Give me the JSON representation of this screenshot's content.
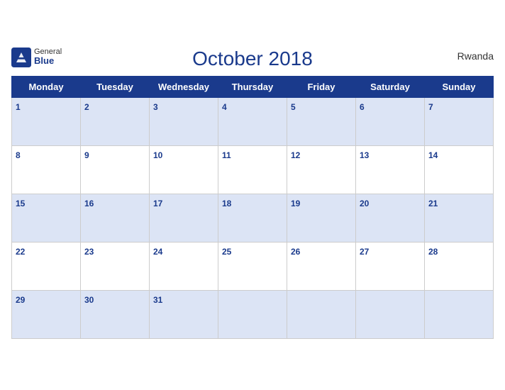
{
  "header": {
    "logo_general": "General",
    "logo_blue": "Blue",
    "month_title": "October 2018",
    "country": "Rwanda"
  },
  "weekdays": [
    "Monday",
    "Tuesday",
    "Wednesday",
    "Thursday",
    "Friday",
    "Saturday",
    "Sunday"
  ],
  "weeks": [
    [
      1,
      2,
      3,
      4,
      5,
      6,
      7
    ],
    [
      8,
      9,
      10,
      11,
      12,
      13,
      14
    ],
    [
      15,
      16,
      17,
      18,
      19,
      20,
      21
    ],
    [
      22,
      23,
      24,
      25,
      26,
      27,
      28
    ],
    [
      29,
      30,
      31,
      null,
      null,
      null,
      null
    ]
  ]
}
